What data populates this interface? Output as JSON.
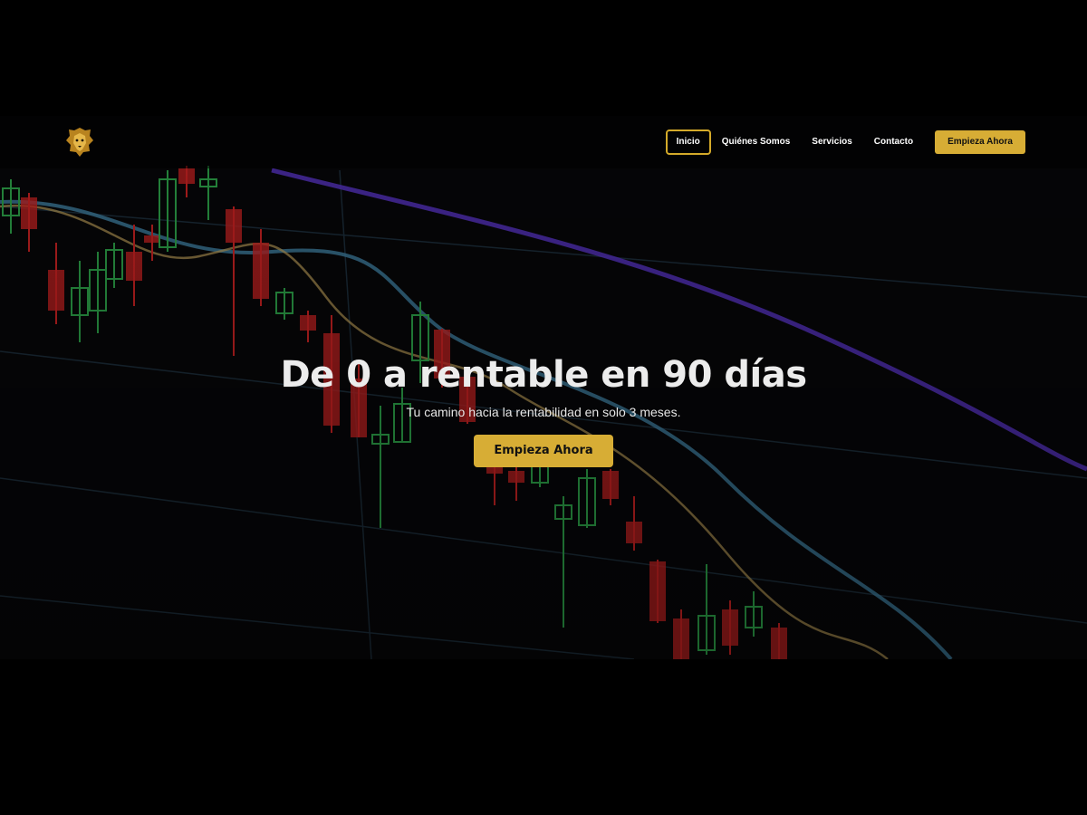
{
  "header": {
    "logo_icon": "lion-head-icon",
    "nav": [
      {
        "label": "Inicio",
        "active": true
      },
      {
        "label": "Quiénes Somos",
        "active": false
      },
      {
        "label": "Servicios",
        "active": false
      },
      {
        "label": "Contacto",
        "active": false
      }
    ],
    "cta_label": "Empieza Ahora"
  },
  "hero": {
    "title": "De 0 a rentable en 90 días",
    "subtitle": "Tu camino hacia la rentabilidad en solo 3 meses.",
    "cta_label": "Empieza Ahora",
    "background": "candlestick-chart-background"
  },
  "colors": {
    "accent": "#d7ad35",
    "background": "#000000",
    "candle_up": "#2a9a45",
    "candle_down": "#c02020"
  }
}
